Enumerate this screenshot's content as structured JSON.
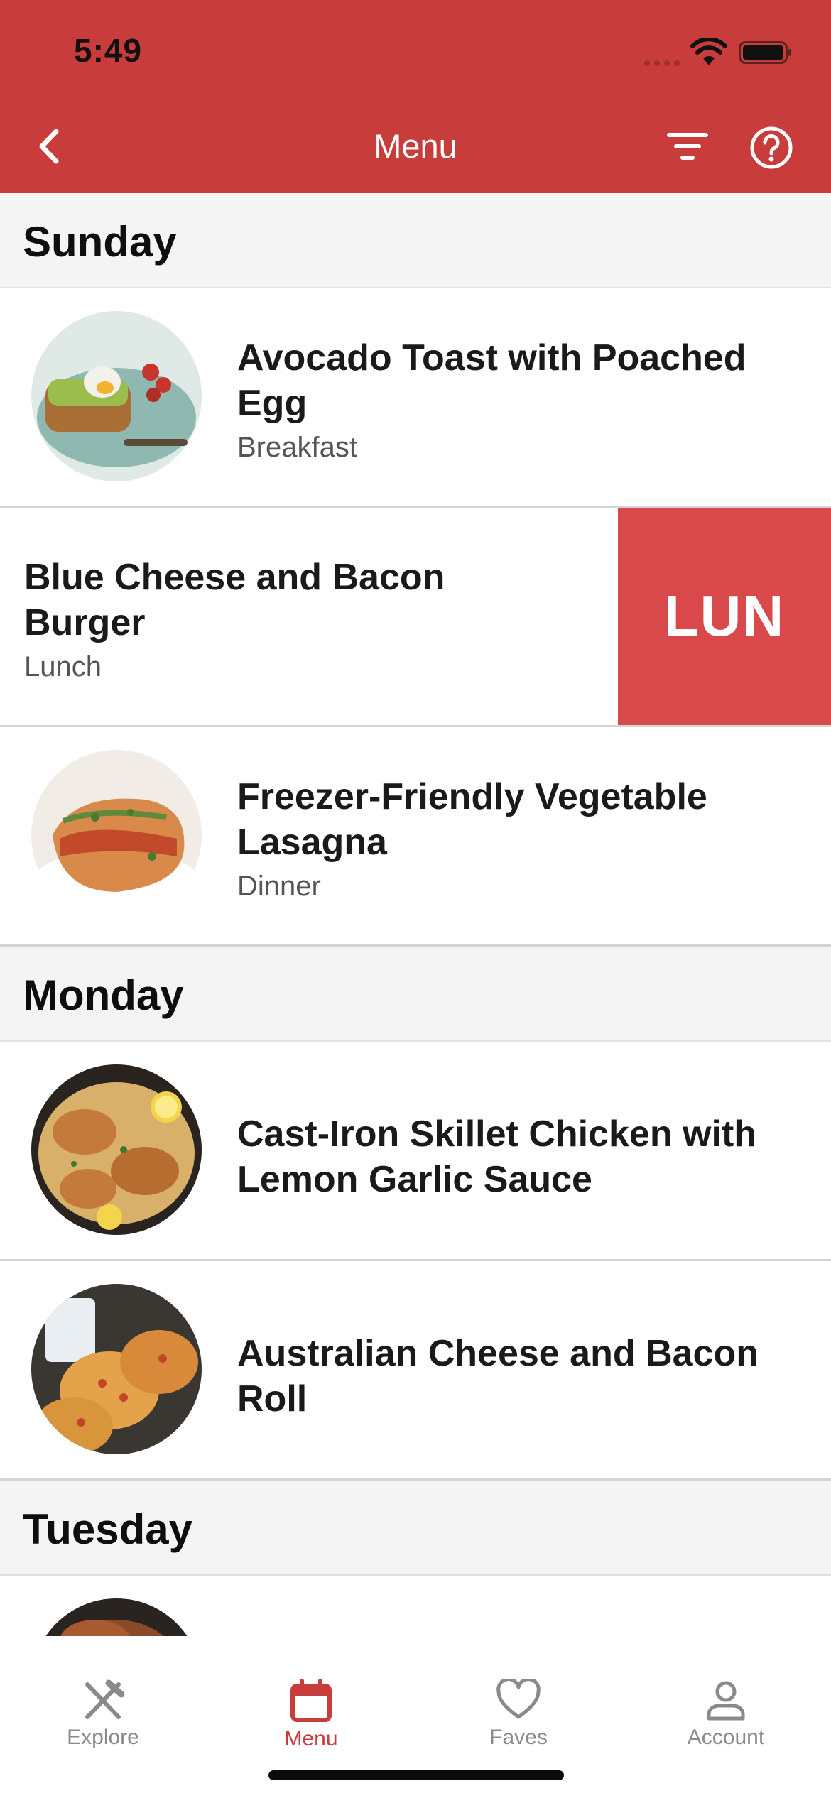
{
  "status_bar": {
    "time": "5:49"
  },
  "header": {
    "title": "Menu",
    "color": "#c83c3c",
    "back_icon": "chevron-left-icon",
    "filter_icon": "filter-icon",
    "help_icon": "help-circle-icon"
  },
  "sections": [
    {
      "day": "Sunday",
      "items": [
        {
          "title": "Avocado Toast with Poached Egg",
          "subtitle": "Breakfast"
        },
        {
          "title": "Blue Cheese and Bacon Burger",
          "subtitle": "Lunch",
          "swipe_action": "LUN"
        },
        {
          "title": "Freezer-Friendly Vegetable Lasagna",
          "subtitle": "Dinner"
        }
      ]
    },
    {
      "day": "Monday",
      "items": [
        {
          "title": "Cast-Iron Skillet Chicken with Lemon Garlic Sauce"
        },
        {
          "title": "Australian Cheese and Bacon Roll"
        }
      ]
    },
    {
      "day": "Tuesday",
      "items": []
    }
  ],
  "tabs": [
    {
      "label": "Explore",
      "icon": "fork-knife-icon",
      "active": false
    },
    {
      "label": "Menu",
      "icon": "calendar-icon",
      "active": true
    },
    {
      "label": "Faves",
      "icon": "heart-icon",
      "active": false
    },
    {
      "label": "Account",
      "icon": "person-icon",
      "active": false
    }
  ],
  "colors": {
    "accent": "#c83c3c",
    "swipe_action": "#d9484b",
    "inactive_tab": "#8a8a8a"
  }
}
